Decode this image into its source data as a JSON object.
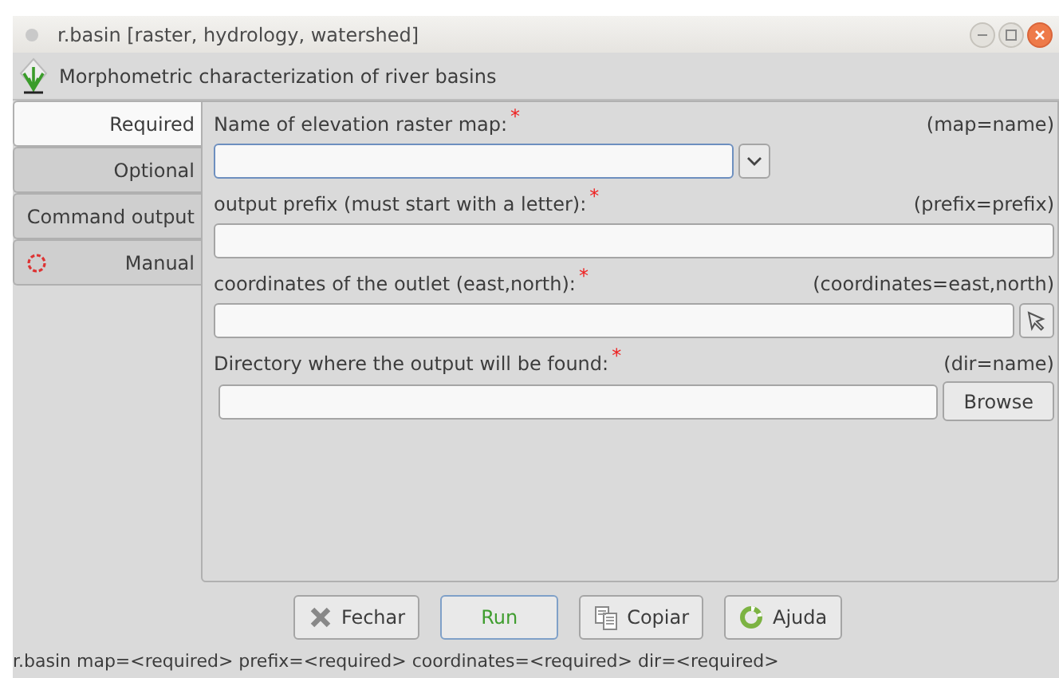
{
  "window": {
    "title": "r.basin [raster, hydrology, watershed]"
  },
  "header": {
    "text": "Morphometric characterization of river basins"
  },
  "tabs": [
    {
      "label": "Required",
      "selected": true
    },
    {
      "label": "Optional",
      "selected": false
    },
    {
      "label": "Command output",
      "selected": false
    },
    {
      "label": "Manual",
      "selected": false,
      "kind": "help"
    }
  ],
  "fields": [
    {
      "label": "Name of elevation raster map:",
      "mark": "*",
      "key": "(map=name)",
      "kind": "combo",
      "focused": true
    },
    {
      "label": "output prefix (must start with a letter):",
      "mark": "*",
      "key": "(prefix=prefix)",
      "kind": "text",
      "focused": false
    },
    {
      "label": "coordinates of the outlet (east,north):",
      "mark": "*",
      "key": "(coordinates=east,north)",
      "kind": "pick",
      "focused": false
    },
    {
      "label": "Directory where the output will be found:",
      "mark": "*",
      "key": "(dir=name)",
      "kind": "browse",
      "focused": false,
      "button": "Browse"
    }
  ],
  "buttons": [
    {
      "label": "Fechar",
      "kind": "close",
      "default": false
    },
    {
      "label": "Run",
      "kind": "plain",
      "default": true
    },
    {
      "label": "Copiar",
      "kind": "copy",
      "default": false
    },
    {
      "label": "Ajuda",
      "kind": "help",
      "default": false
    }
  ],
  "status_bar": "r.basin map=<required> prefix=<required> coordinates=<required> dir=<required>"
}
